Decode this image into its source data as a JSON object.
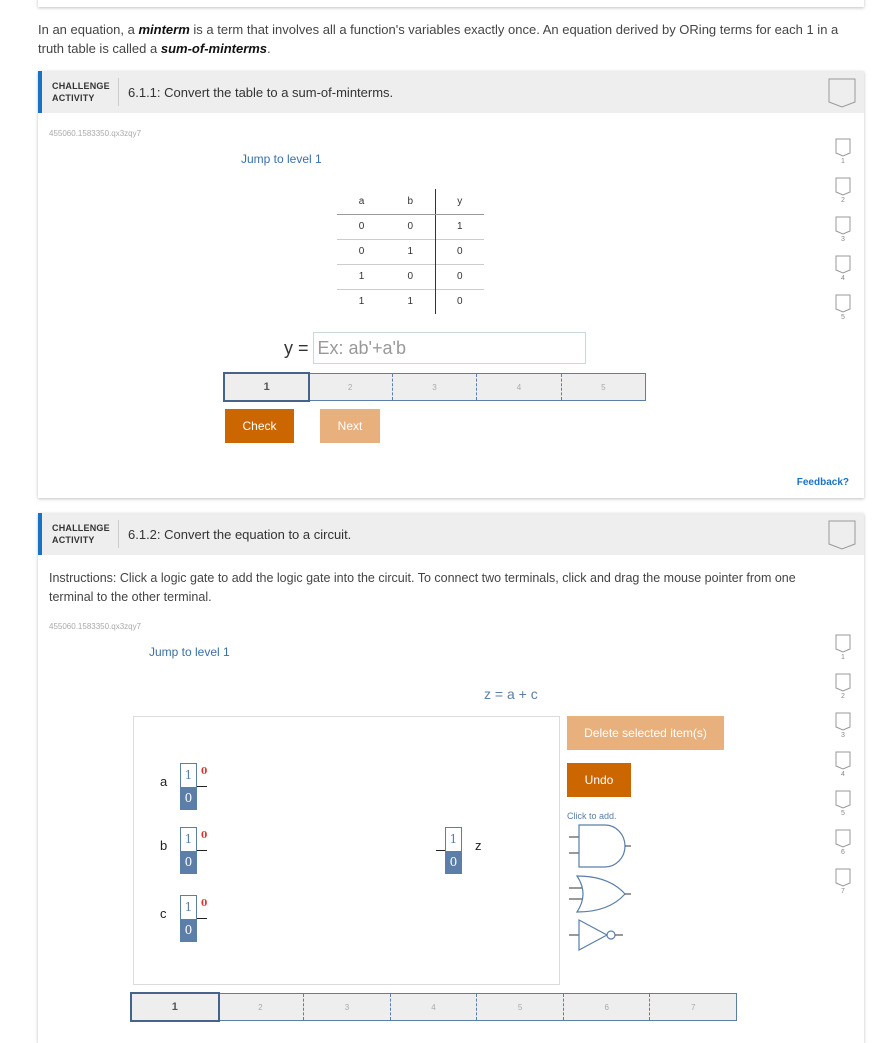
{
  "intro": {
    "prefix": "In an equation, a ",
    "term1": "minterm",
    "middle": " is a term that involves all a function's variables exactly once. An equation derived by ORing terms for each 1 in a truth table is called a ",
    "term2": "sum-of-minterms",
    "suffix": "."
  },
  "activity1": {
    "label_line1": "CHALLENGE",
    "label_line2": "ACTIVITY",
    "title": "6.1.1: Convert the table to a sum-of-minterms.",
    "activity_id": "455060.1583350.qx3zqy7",
    "jump_link": "Jump to level 1",
    "truth_table": {
      "headers": [
        "a",
        "b",
        "y"
      ],
      "rows": [
        [
          "0",
          "0",
          "1"
        ],
        [
          "0",
          "1",
          "0"
        ],
        [
          "1",
          "0",
          "0"
        ],
        [
          "1",
          "1",
          "0"
        ]
      ]
    },
    "equation_label": "y =",
    "equation_placeholder": "Ex: ab'+a'b",
    "equation_value": "",
    "levels": [
      "1",
      "2",
      "3",
      "4",
      "5"
    ],
    "active_level": 1,
    "check_label": "Check",
    "next_label": "Next",
    "feedback_label": "Feedback?",
    "side_steps": [
      "1",
      "2",
      "3",
      "4",
      "5"
    ]
  },
  "activity2": {
    "label_line1": "CHALLENGE",
    "label_line2": "ACTIVITY",
    "title": "6.1.2: Convert the equation to a circuit.",
    "instructions": "Instructions: Click a logic gate to add the logic gate into the circuit. To connect two terminals, click and drag the mouse pointer from one terminal to the other terminal.",
    "activity_id": "455060.1583350.qx3zqy7",
    "jump_link": "Jump to level 1",
    "equation": "z = a + c",
    "inputs": [
      {
        "name": "a",
        "top": "1",
        "bottom": "0",
        "value": "0"
      },
      {
        "name": "b",
        "top": "1",
        "bottom": "0",
        "value": "0"
      },
      {
        "name": "c",
        "top": "1",
        "bottom": "0",
        "value": "0"
      }
    ],
    "output": {
      "name": "z",
      "top": "1",
      "bottom": "0"
    },
    "delete_label": "Delete selected item(s)",
    "undo_label": "Undo",
    "click_to_add": "Click to add.",
    "gates": [
      "and-gate",
      "or-gate",
      "not-gate"
    ],
    "levels": [
      "1",
      "2",
      "3",
      "4",
      "5",
      "6",
      "7"
    ],
    "active_level": 1,
    "side_steps": [
      "1",
      "2",
      "3",
      "4",
      "5",
      "6",
      "7"
    ]
  },
  "colors": {
    "accent_blue": "#1a73c2",
    "primary_button": "#cc6600",
    "disabled_button": "#e8b07c",
    "toggle_blue": "#5b7fa8",
    "output_red": "#dd3333"
  }
}
